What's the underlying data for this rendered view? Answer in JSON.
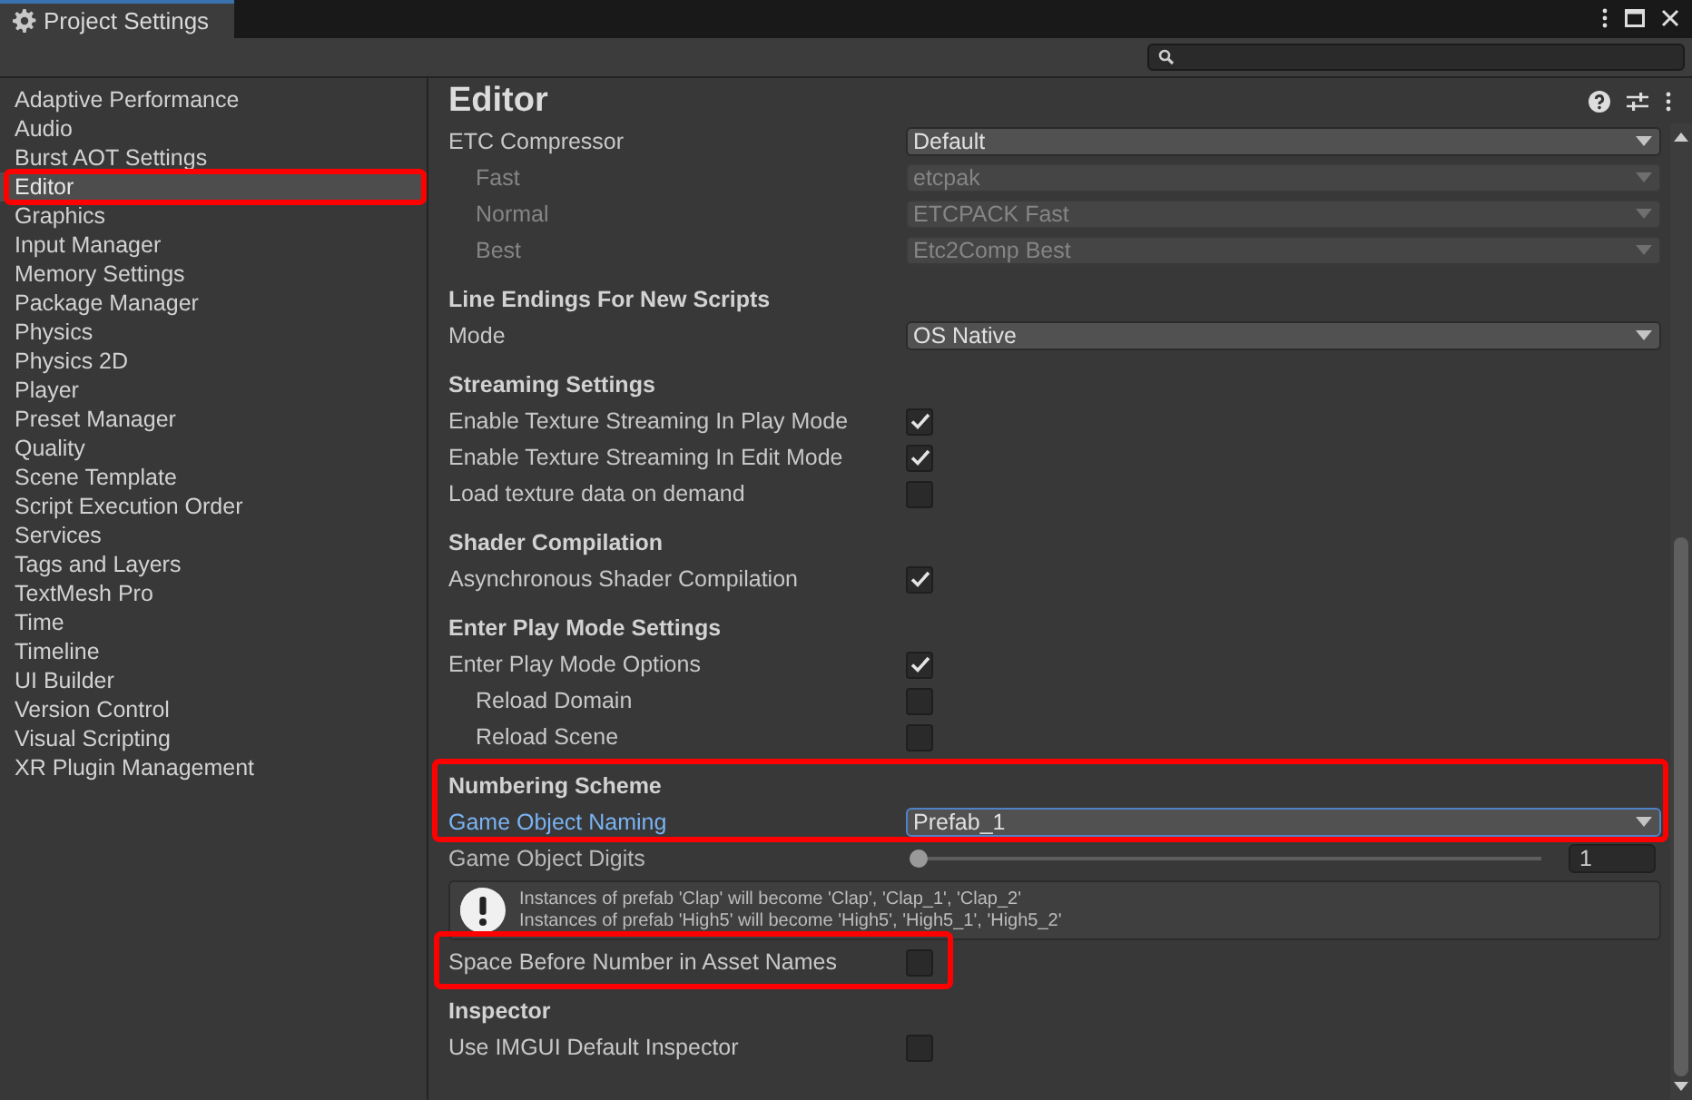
{
  "window": {
    "title": "Project Settings"
  },
  "sidebar": {
    "items": [
      {
        "label": "Adaptive Performance",
        "selected": false,
        "highlighted": false
      },
      {
        "label": "Audio",
        "selected": false,
        "highlighted": false
      },
      {
        "label": "Burst AOT Settings",
        "selected": false,
        "highlighted": false
      },
      {
        "label": "Editor",
        "selected": true,
        "highlighted": true
      },
      {
        "label": "Graphics",
        "selected": false,
        "highlighted": false
      },
      {
        "label": "Input Manager",
        "selected": false,
        "highlighted": false
      },
      {
        "label": "Memory Settings",
        "selected": false,
        "highlighted": false
      },
      {
        "label": "Package Manager",
        "selected": false,
        "highlighted": false
      },
      {
        "label": "Physics",
        "selected": false,
        "highlighted": false
      },
      {
        "label": "Physics 2D",
        "selected": false,
        "highlighted": false
      },
      {
        "label": "Player",
        "selected": false,
        "highlighted": false
      },
      {
        "label": "Preset Manager",
        "selected": false,
        "highlighted": false
      },
      {
        "label": "Quality",
        "selected": false,
        "highlighted": false
      },
      {
        "label": "Scene Template",
        "selected": false,
        "highlighted": false
      },
      {
        "label": "Script Execution Order",
        "selected": false,
        "highlighted": false
      },
      {
        "label": "Services",
        "selected": false,
        "highlighted": false
      },
      {
        "label": "Tags and Layers",
        "selected": false,
        "highlighted": false
      },
      {
        "label": "TextMesh Pro",
        "selected": false,
        "highlighted": false
      },
      {
        "label": "Time",
        "selected": false,
        "highlighted": false
      },
      {
        "label": "Timeline",
        "selected": false,
        "highlighted": false
      },
      {
        "label": "UI Builder",
        "selected": false,
        "highlighted": false
      },
      {
        "label": "Version Control",
        "selected": false,
        "highlighted": false
      },
      {
        "label": "Visual Scripting",
        "selected": false,
        "highlighted": false
      },
      {
        "label": "XR Plugin Management",
        "selected": false,
        "highlighted": false
      }
    ]
  },
  "panel": {
    "title": "Editor",
    "sections": [
      {
        "highlighted": false,
        "rows": [
          {
            "kind": "dropdown",
            "label": "ETC Compressor",
            "value": "Default",
            "disabled": false,
            "focused": false,
            "highlighted": false,
            "children": [
              {
                "kind": "dropdown",
                "label": "Fast",
                "value": "etcpak",
                "disabled": true,
                "focused": false,
                "highlighted": false
              },
              {
                "kind": "dropdown",
                "label": "Normal",
                "value": "ETCPACK Fast",
                "disabled": true,
                "focused": false,
                "highlighted": false
              },
              {
                "kind": "dropdown",
                "label": "Best",
                "value": "Etc2Comp Best",
                "disabled": true,
                "focused": false,
                "highlighted": false
              }
            ]
          }
        ]
      },
      {
        "heading": "Line Endings For New Scripts",
        "highlighted": false,
        "rows": [
          {
            "kind": "dropdown",
            "label": "Mode",
            "value": "OS Native",
            "disabled": false,
            "focused": false,
            "highlighted": false
          }
        ]
      },
      {
        "heading": "Streaming Settings",
        "highlighted": false,
        "rows": [
          {
            "kind": "checkbox",
            "label": "Enable Texture Streaming In Play Mode",
            "checked": true,
            "highlighted": false
          },
          {
            "kind": "checkbox",
            "label": "Enable Texture Streaming In Edit Mode",
            "checked": true,
            "highlighted": false
          },
          {
            "kind": "checkbox",
            "label": "Load texture data on demand",
            "checked": false,
            "highlighted": false
          }
        ]
      },
      {
        "heading": "Shader Compilation",
        "highlighted": false,
        "rows": [
          {
            "kind": "checkbox",
            "label": "Asynchronous Shader Compilation",
            "checked": true,
            "highlighted": false
          }
        ]
      },
      {
        "heading": "Enter Play Mode Settings",
        "highlighted": false,
        "rows": [
          {
            "kind": "checkbox",
            "label": "Enter Play Mode Options",
            "checked": true,
            "highlighted": false,
            "children": [
              {
                "kind": "checkbox",
                "label": "Reload Domain",
                "checked": false,
                "highlighted": false
              },
              {
                "kind": "checkbox",
                "label": "Reload Scene",
                "checked": false,
                "highlighted": false
              }
            ]
          }
        ]
      },
      {
        "heading": "Numbering Scheme",
        "highlighted": true,
        "rows": [
          {
            "kind": "dropdown",
            "label": "Game Object Naming",
            "value": "Prefab_1",
            "disabled": false,
            "focused": true,
            "highlighted": false
          }
        ]
      },
      {
        "highlighted": false,
        "rows": [
          {
            "kind": "slider",
            "label": "Game Object Digits",
            "level": 0,
            "value": "1",
            "highlighted": false
          },
          {
            "kind": "helpbox",
            "lines": [
              "Instances of prefab 'Clap' will become 'Clap', 'Clap_1', 'Clap_2'",
              "Instances of prefab 'High5' will become 'High5', 'High5_1', 'High5_2'"
            ],
            "highlighted": false
          },
          {
            "kind": "checkbox",
            "label": "Space Before Number in Asset Names",
            "checked": false,
            "highlighted": true
          }
        ]
      },
      {
        "heading": "Inspector",
        "highlighted": false,
        "rows": [
          {
            "kind": "checkbox",
            "label": "Use IMGUI Default Inspector",
            "checked": false,
            "highlighted": false
          }
        ]
      }
    ]
  }
}
